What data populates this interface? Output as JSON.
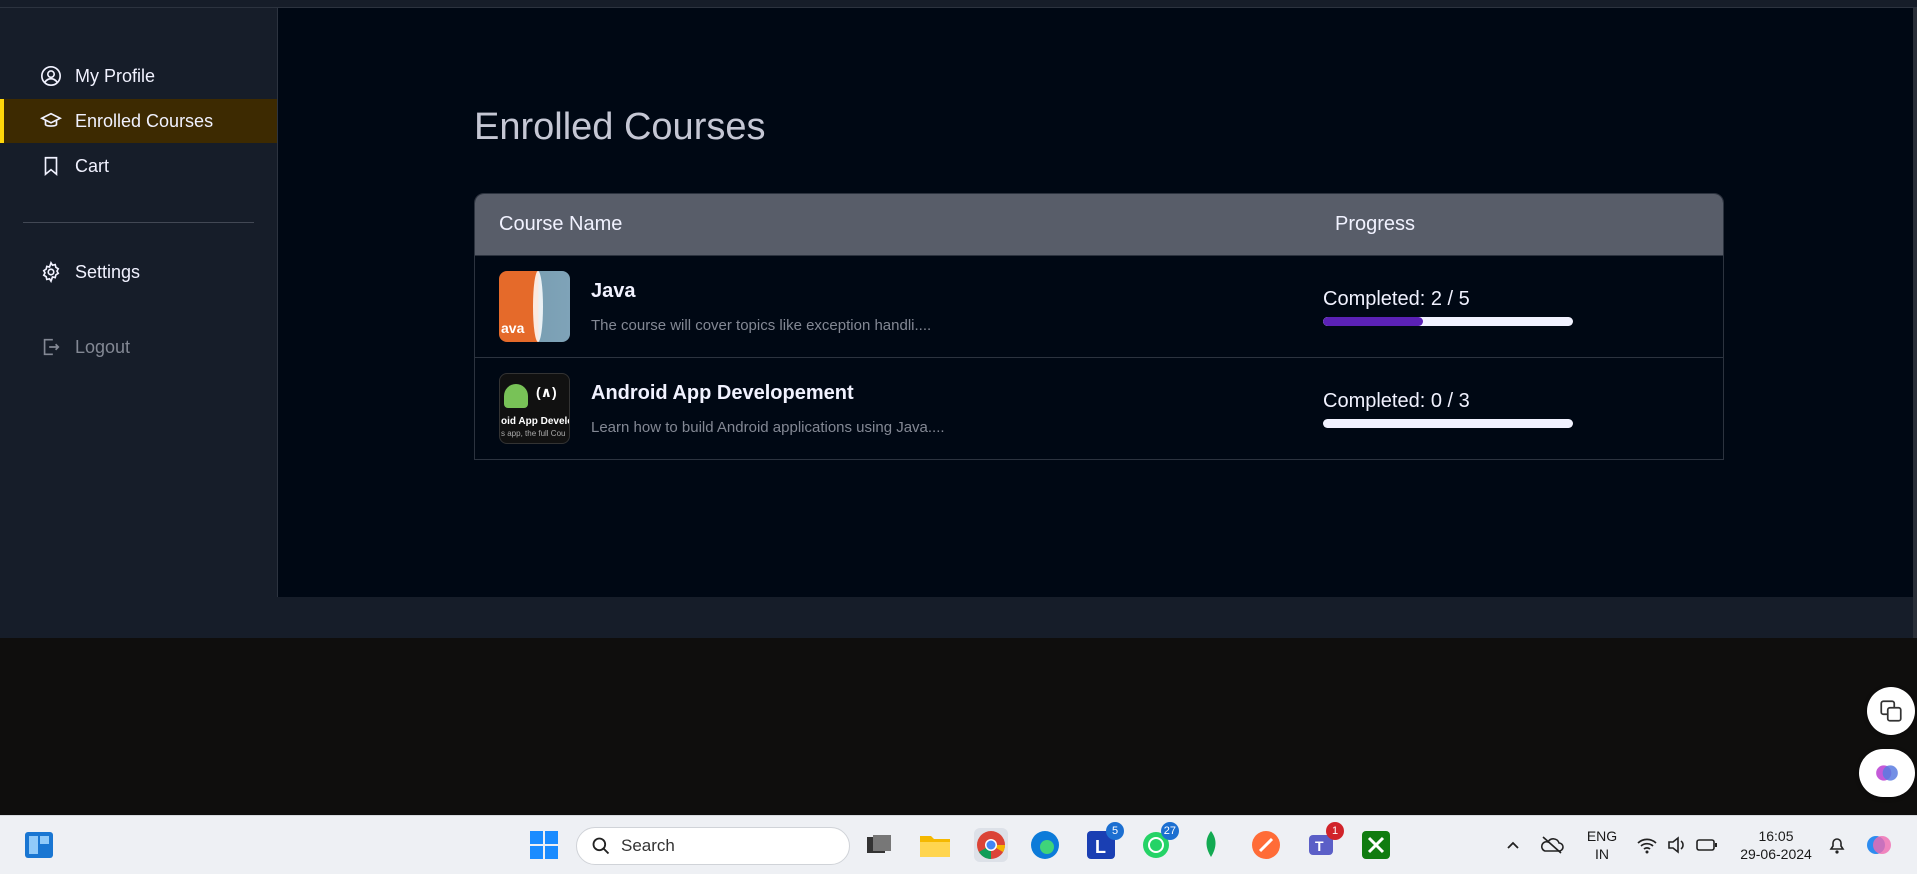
{
  "sidebar": {
    "items": [
      {
        "label": "My Profile",
        "icon": "user-circle-icon"
      },
      {
        "label": "Enrolled Courses",
        "icon": "graduation-cap-icon"
      },
      {
        "label": "Cart",
        "icon": "bookmark-icon"
      }
    ],
    "settings_label": "Settings",
    "logout_label": "Logout",
    "accent_color": "#ffd60a"
  },
  "main": {
    "title": "Enrolled Courses",
    "table": {
      "headers": {
        "course_name": "Course Name",
        "progress": "Progress"
      },
      "rows": [
        {
          "title": "Java",
          "description": "The course will cover topics like exception handli....",
          "thumb_text": "ava",
          "progress_label": "Completed: 2 / 5",
          "progress_fraction": 0.4
        },
        {
          "title": "Android App Developement",
          "description": "Learn how to build Android applications using Java....",
          "thumb_text": "oid App Develop",
          "thumb_subtext": "s app, the full Cou",
          "thumb_logo_text": "(∧)",
          "progress_label": "Completed: 0 / 3",
          "progress_fraction": 0
        }
      ]
    }
  },
  "taskbar": {
    "search_placeholder": "Search",
    "badges": {
      "teams_l": "5",
      "whatsapp": "27",
      "teams_new": "1"
    },
    "language": "ENG",
    "region": "IN",
    "time": "16:05",
    "date": "29-06-2024"
  }
}
